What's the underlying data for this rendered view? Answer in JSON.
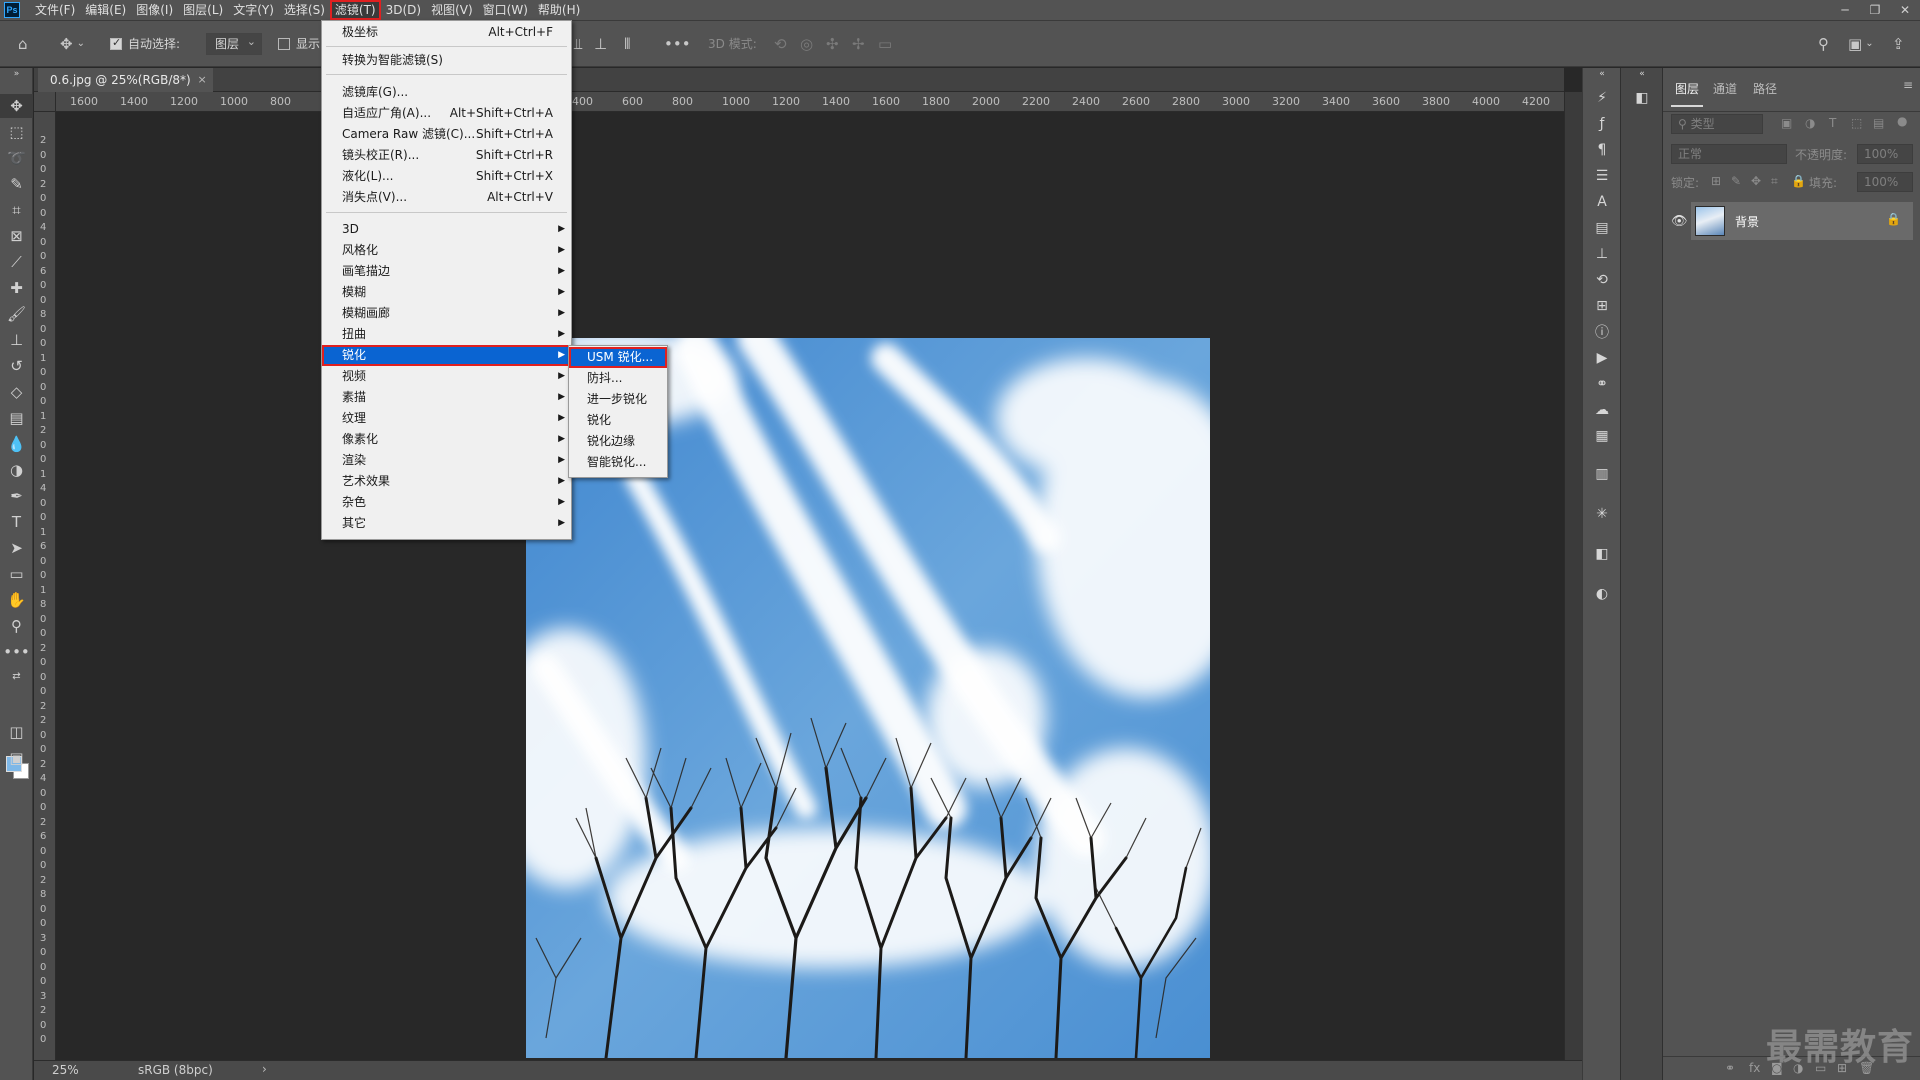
{
  "menubar": {
    "logo": "Ps",
    "items": [
      "文件(F)",
      "编辑(E)",
      "图像(I)",
      "图层(L)",
      "文字(Y)",
      "选择(S)",
      "滤镜(T)",
      "3D(D)",
      "视图(V)",
      "窗口(W)",
      "帮助(H)"
    ],
    "active_index": 6,
    "window_controls": [
      "─",
      "❐",
      "✕"
    ]
  },
  "options_bar": {
    "auto_select_label": "自动选择:",
    "auto_select_target": "图层",
    "show_label": "显示",
    "mode_3d_label": "3D 模式:"
  },
  "document": {
    "tab_title": "0.6.jpg @ 25%(RGB/8*)",
    "tab_close": "×",
    "ruler_h_left": [
      "1600",
      "1400",
      "1200",
      "1000",
      "800"
    ],
    "ruler_h_right": [
      "400",
      "600",
      "800",
      "1000",
      "1200",
      "1400",
      "1600",
      "1800",
      "2000",
      "2200",
      "2400",
      "2600",
      "2800",
      "3000",
      "3200",
      "3400",
      "3600",
      "3800",
      "4000",
      "4200"
    ],
    "ruler_v": [
      "2",
      "0",
      "0",
      "2",
      "0",
      "0",
      "4",
      "0",
      "0",
      "6",
      "0",
      "0",
      "8",
      "0",
      "0",
      "1",
      "0",
      "0",
      "0",
      "1",
      "2",
      "0",
      "0",
      "1",
      "4",
      "0",
      "0",
      "1",
      "6",
      "0",
      "0",
      "1",
      "8",
      "0",
      "0",
      "2",
      "0",
      "0",
      "0",
      "2",
      "2",
      "0",
      "0",
      "2",
      "4",
      "0",
      "0",
      "2",
      "6",
      "0",
      "0",
      "2",
      "8",
      "0",
      "0",
      "3",
      "0",
      "0",
      "0",
      "3",
      "2",
      "0",
      "0"
    ]
  },
  "status_bar": {
    "zoom": "25%",
    "profile": "sRGB (8bpc)",
    "arrow": "›"
  },
  "filter_menu": {
    "items": [
      {
        "label": "极坐标",
        "shortcut": "Alt+Ctrl+F"
      },
      {
        "label": "转换为智能滤镜(S)",
        "shortcut": ""
      },
      {
        "label": "滤镜库(G)...",
        "shortcut": ""
      },
      {
        "label": "自适应广角(A)...",
        "shortcut": "Alt+Shift+Ctrl+A"
      },
      {
        "label": "Camera Raw 滤镜(C)...",
        "shortcut": "Shift+Ctrl+A"
      },
      {
        "label": "镜头校正(R)...",
        "shortcut": "Shift+Ctrl+R"
      },
      {
        "label": "液化(L)...",
        "shortcut": "Shift+Ctrl+X"
      },
      {
        "label": "消失点(V)...",
        "shortcut": "Alt+Ctrl+V"
      },
      {
        "label": "3D",
        "shortcut": ""
      },
      {
        "label": "风格化",
        "shortcut": ""
      },
      {
        "label": "画笔描边",
        "shortcut": ""
      },
      {
        "label": "模糊",
        "shortcut": ""
      },
      {
        "label": "模糊画廊",
        "shortcut": ""
      },
      {
        "label": "扭曲",
        "shortcut": ""
      },
      {
        "label": "锐化",
        "shortcut": ""
      },
      {
        "label": "视频",
        "shortcut": ""
      },
      {
        "label": "素描",
        "shortcut": ""
      },
      {
        "label": "纹理",
        "shortcut": ""
      },
      {
        "label": "像素化",
        "shortcut": ""
      },
      {
        "label": "渲染",
        "shortcut": ""
      },
      {
        "label": "艺术效果",
        "shortcut": ""
      },
      {
        "label": "杂色",
        "shortcut": ""
      },
      {
        "label": "其它",
        "shortcut": ""
      }
    ],
    "highlighted": "锐化"
  },
  "sharpen_submenu": {
    "items": [
      "USM 锐化...",
      "防抖...",
      "进一步锐化",
      "锐化",
      "锐化边缘",
      "智能锐化..."
    ],
    "highlighted": "USM 锐化..."
  },
  "layers_panel": {
    "tabs": [
      "图层",
      "通道",
      "路径"
    ],
    "active_tab": "图层",
    "filter_placeholder": "类型",
    "blend_mode": "正常",
    "opacity_label": "不透明度:",
    "opacity_value": "100%",
    "lock_label": "锁定:",
    "fill_label": "填充:",
    "fill_value": "100%",
    "layer_name": "背景"
  },
  "watermark": "最需教育",
  "colors": {
    "accent_highlight": "#0a64d2",
    "annotation_red": "#e02020",
    "foreground_swatch": "#7eb8e8",
    "background_swatch": "#ffffff"
  }
}
